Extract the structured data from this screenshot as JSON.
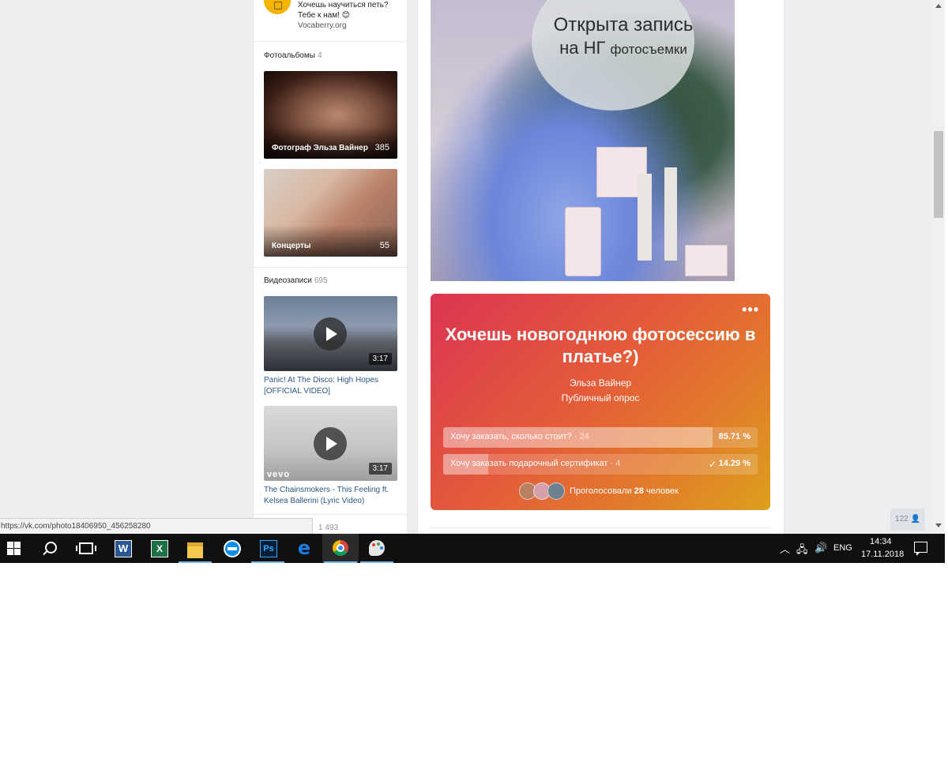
{
  "ad": {
    "line1": "Хочешь научиться петь?",
    "line2": "Тебе к нам!",
    "emoji": "😊",
    "link": "Vocaberry.org"
  },
  "albums": {
    "title": "Фотоальбомы",
    "count": "4",
    "items": [
      {
        "name": "Фотограф Эльза Вайнер",
        "count": "385"
      },
      {
        "name": "Концерты",
        "count": "55"
      }
    ]
  },
  "videos": {
    "title": "Видеозаписи",
    "count": "695",
    "items": [
      {
        "title": "Panic! At The Disco: High Hopes [OFFICIAL VIDEO]",
        "duration": "3:17"
      },
      {
        "title": "The Chainsmokers - This Feeling ft. Kelsea Ballerini (Lyric Video)",
        "duration": "3:17",
        "watermark": "vevo"
      }
    ]
  },
  "hidden_section_count": "1 493",
  "status_url": "https://vk.com/photo18406950_456258280",
  "post_photo": {
    "caption_line1": "Открыта запись",
    "caption_line2_big": "на НГ",
    "caption_line2_small": "фотосъемки"
  },
  "poll": {
    "menu": "•••",
    "title": "Хочешь новогоднюю фотосессию в платье?)",
    "author": "Эльза Вайнер",
    "type": "Публичный опрос",
    "options": [
      {
        "label": "Хочу заказать, сколько стоит?",
        "votes": "24",
        "percent_text": "85.71 %",
        "fraction": 0.8571,
        "selected": false
      },
      {
        "label": "Хочу заказать подарочный сертификат",
        "votes": "4",
        "percent_text": "14.29 %",
        "fraction": 0.1429,
        "selected": true
      }
    ],
    "voted_prefix": "Проголосовали",
    "voted_count": "28",
    "voted_suffix": "человек"
  },
  "online_badge": "122",
  "taskbar": {
    "apps": [
      {
        "name": "word",
        "glyph": "W"
      },
      {
        "name": "excel",
        "glyph": "X"
      },
      {
        "name": "file-explorer",
        "glyph": ""
      },
      {
        "name": "teamviewer",
        "glyph": ""
      },
      {
        "name": "photoshop",
        "glyph": "Ps"
      },
      {
        "name": "edge",
        "glyph": "e"
      },
      {
        "name": "chrome",
        "glyph": ""
      },
      {
        "name": "paint",
        "glyph": ""
      }
    ],
    "language": "ENG",
    "time": "14:34",
    "date": "17.11.2018"
  },
  "colors": {
    "poll_gradient_start": "#db3552",
    "poll_gradient_end": "#dca01c",
    "link": "#2a5885",
    "page_bg": "#edeef0",
    "taskbar": "#101010"
  }
}
